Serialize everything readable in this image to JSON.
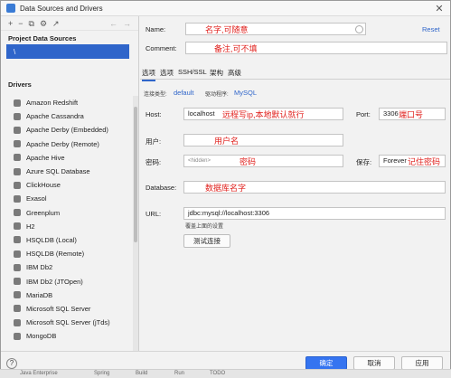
{
  "window": {
    "title": "Data Sources and Drivers",
    "close": "✕"
  },
  "toolbar": {
    "add": "+",
    "remove": "−",
    "copy": "⧉",
    "settings": "⚙",
    "edit": "↗",
    "back": "←",
    "forward": "→"
  },
  "left": {
    "project_title": "Project Data Sources",
    "project_item_icon": "\\",
    "drivers_title": "Drivers",
    "drivers": [
      "Amazon Redshift",
      "Apache Cassandra",
      "Apache Derby (Embedded)",
      "Apache Derby (Remote)",
      "Apache Hive",
      "Azure SQL Database",
      "ClickHouse",
      "Exasol",
      "Greenplum",
      "H2",
      "HSQLDB (Local)",
      "HSQLDB (Remote)",
      "IBM Db2",
      "IBM Db2 (JTOpen)",
      "MariaDB",
      "Microsoft SQL Server",
      "Microsoft SQL Server (jTds)",
      "MongoDB"
    ]
  },
  "form": {
    "name_label": "Name:",
    "name_annotation": "名字,可随意",
    "reset": "Reset",
    "comment_label": "Comment:",
    "comment_annotation": "备注,可不填",
    "tabs": [
      "选项",
      "选项",
      "SSH/SSL",
      "架构",
      "高级"
    ],
    "conn_type_label": "连接类型:",
    "conn_type_value": "default",
    "driver_label": "驱动程序:",
    "driver_value": "MySQL",
    "host_label": "Host:",
    "host_value": "localhost",
    "host_annotation": "远程写ip,本地默认就行",
    "port_label": "Port:",
    "port_value": "3306",
    "port_annotation": "端口号",
    "user_label": "用户:",
    "user_annotation": "用户名",
    "password_label": "密码:",
    "password_value": "<hidden>",
    "password_annotation": "密码",
    "save_label": "保存:",
    "save_value": "Forever",
    "save_annotation": "记住密码",
    "database_label": "Database:",
    "database_annotation": "数据库名字",
    "url_label": "URL:",
    "url_value": "jdbc:mysql://localhost:3306",
    "url_hint": "覆盖上面的设置",
    "test_button": "测试连接"
  },
  "buttons": {
    "ok": "确定",
    "cancel": "取消",
    "apply": "应用",
    "help": "?"
  },
  "statusbar": [
    "Java Enterprise",
    "Spring",
    "Build",
    "Run",
    "TODO"
  ]
}
